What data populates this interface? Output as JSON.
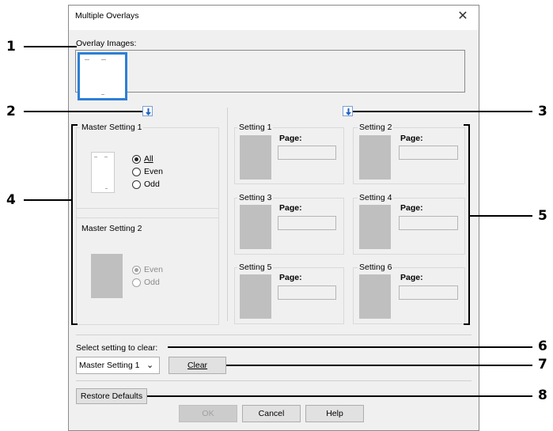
{
  "dialog": {
    "title": "Multiple Overlays",
    "close_glyph": "✕",
    "overlay_images_label": "Overlay Images:",
    "master1": {
      "title": "Master Setting 1",
      "options": [
        "All",
        "Even",
        "Odd"
      ],
      "selected": "All"
    },
    "master2": {
      "title": "Master Setting 2",
      "options": [
        "Even",
        "Odd"
      ],
      "selected": "Even"
    },
    "settings": [
      {
        "title": "Setting 1",
        "page_label": "Page:",
        "page_value": ""
      },
      {
        "title": "Setting 2",
        "page_label": "Page:",
        "page_value": ""
      },
      {
        "title": "Setting 3",
        "page_label": "Page:",
        "page_value": ""
      },
      {
        "title": "Setting 4",
        "page_label": "Page:",
        "page_value": ""
      },
      {
        "title": "Setting 5",
        "page_label": "Page:",
        "page_value": ""
      },
      {
        "title": "Setting 6",
        "page_label": "Page:",
        "page_value": ""
      }
    ],
    "clear_label": "Select setting to clear:",
    "clear_select_value": "Master Setting 1",
    "clear_button": "Clear",
    "restore_button": "Restore Defaults",
    "ok_button": "OK",
    "cancel_button": "Cancel",
    "help_button": "Help"
  },
  "callouts": [
    "1",
    "2",
    "3",
    "4",
    "5",
    "6",
    "7",
    "8"
  ],
  "colors": {
    "dialog_bg": "#f0f0f0",
    "selection_blue": "#2d7fd6",
    "placeholder_grey": "#bfbfbf"
  }
}
